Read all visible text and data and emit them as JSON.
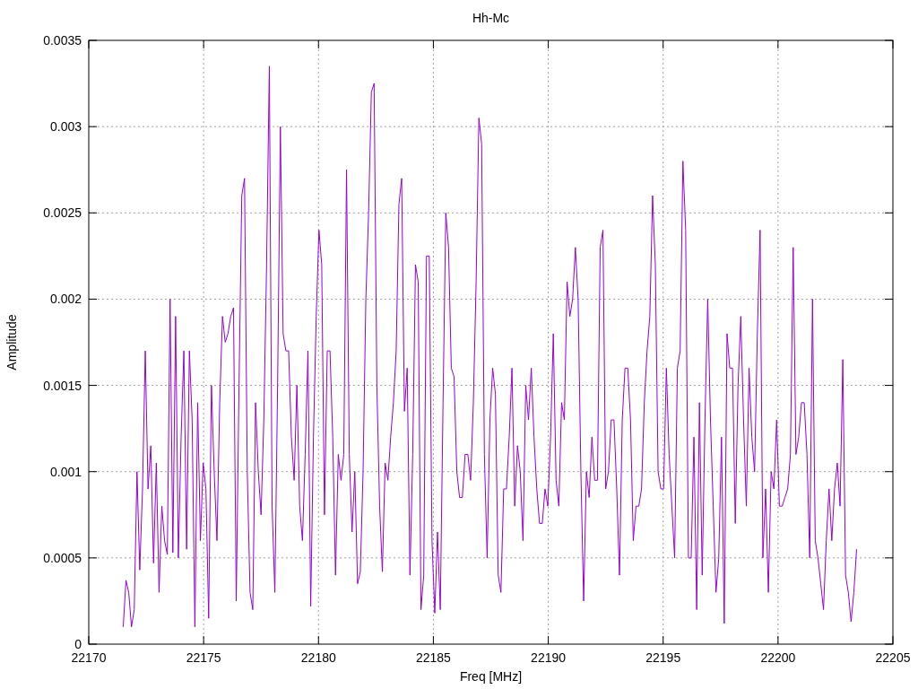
{
  "chart_data": {
    "type": "line",
    "title": "Hh-Mc",
    "xlabel": "Freq [MHz]",
    "ylabel": "Amplitude",
    "xlim": [
      22170,
      22205
    ],
    "ylim": [
      0,
      0.0035
    ],
    "xticks": [
      22170,
      22175,
      22180,
      22185,
      22190,
      22195,
      22200,
      22205
    ],
    "yticks": [
      0,
      0.0005,
      0.001,
      0.0015,
      0.002,
      0.0025,
      0.003,
      0.0035
    ],
    "x": [
      22171.5,
      22171.62,
      22171.74,
      22171.86,
      22171.98,
      22172.1,
      22172.22,
      22172.34,
      22172.46,
      22172.58,
      22172.7,
      22172.82,
      22172.94,
      22173.06,
      22173.18,
      22173.3,
      22173.42,
      22173.54,
      22173.66,
      22173.78,
      22173.9,
      22174.02,
      22174.14,
      22174.26,
      22174.38,
      22174.5,
      22174.62,
      22174.74,
      22174.86,
      22174.98,
      22175.1,
      22175.22,
      22175.34,
      22175.46,
      22175.58,
      22175.7,
      22175.82,
      22175.94,
      22176.06,
      22176.18,
      22176.3,
      22176.42,
      22176.54,
      22176.66,
      22176.78,
      22176.9,
      22177.02,
      22177.14,
      22177.26,
      22177.38,
      22177.5,
      22177.62,
      22177.74,
      22177.86,
      22177.98,
      22178.1,
      22178.22,
      22178.34,
      22178.46,
      22178.58,
      22178.7,
      22178.82,
      22178.94,
      22179.06,
      22179.18,
      22179.3,
      22179.42,
      22179.54,
      22179.66,
      22179.78,
      22179.9,
      22180.02,
      22180.14,
      22180.26,
      22180.38,
      22180.5,
      22180.62,
      22180.74,
      22180.86,
      22180.98,
      22181.1,
      22181.22,
      22181.34,
      22181.46,
      22181.58,
      22181.7,
      22181.82,
      22181.94,
      22182.06,
      22182.18,
      22182.3,
      22182.42,
      22182.54,
      22182.66,
      22182.78,
      22182.9,
      22183.02,
      22183.14,
      22183.26,
      22183.38,
      22183.5,
      22183.62,
      22183.74,
      22183.86,
      22183.98,
      22184.1,
      22184.22,
      22184.34,
      22184.46,
      22184.58,
      22184.7,
      22184.82,
      22184.94,
      22185.06,
      22185.18,
      22185.3,
      22185.42,
      22185.54,
      22185.66,
      22185.78,
      22185.9,
      22186.02,
      22186.14,
      22186.26,
      22186.38,
      22186.5,
      22186.62,
      22186.74,
      22186.86,
      22186.98,
      22187.1,
      22187.22,
      22187.34,
      22187.46,
      22187.58,
      22187.7,
      22187.82,
      22187.94,
      22188.06,
      22188.18,
      22188.3,
      22188.42,
      22188.54,
      22188.66,
      22188.78,
      22188.9,
      22189.02,
      22189.14,
      22189.26,
      22189.38,
      22189.5,
      22189.62,
      22189.74,
      22189.86,
      22189.98,
      22190.1,
      22190.22,
      22190.34,
      22190.46,
      22190.58,
      22190.7,
      22190.82,
      22190.94,
      22191.06,
      22191.18,
      22191.3,
      22191.42,
      22191.54,
      22191.66,
      22191.78,
      22191.9,
      22192.02,
      22192.14,
      22192.26,
      22192.38,
      22192.5,
      22192.62,
      22192.74,
      22192.86,
      22192.98,
      22193.1,
      22193.22,
      22193.34,
      22193.46,
      22193.58,
      22193.7,
      22193.82,
      22193.94,
      22194.06,
      22194.18,
      22194.3,
      22194.42,
      22194.54,
      22194.66,
      22194.78,
      22194.9,
      22195.02,
      22195.14,
      22195.26,
      22195.38,
      22195.5,
      22195.62,
      22195.74,
      22195.86,
      22195.98,
      22196.1,
      22196.22,
      22196.34,
      22196.46,
      22196.58,
      22196.7,
      22196.82,
      22196.94,
      22197.06,
      22197.18,
      22197.3,
      22197.42,
      22197.54,
      22197.66,
      22197.78,
      22197.9,
      22198.02,
      22198.14,
      22198.26,
      22198.38,
      22198.5,
      22198.62,
      22198.74,
      22198.86,
      22198.98,
      22199.1,
      22199.22,
      22199.34,
      22199.46,
      22199.58,
      22199.7,
      22199.82,
      22199.94,
      22200.06,
      22200.18,
      22200.3,
      22200.42,
      22200.54,
      22200.66,
      22200.78,
      22200.9,
      22201.02,
      22201.14,
      22201.26,
      22201.38,
      22201.5,
      22201.62,
      22201.74,
      22201.86,
      22201.98,
      22202.1,
      22202.22,
      22202.34,
      22202.46,
      22202.58,
      22202.7,
      22202.82,
      22202.94,
      22203.06,
      22203.18,
      22203.3,
      22203.42
    ],
    "grid": true,
    "series": [
      {
        "color": "#9400d3",
        "values": [
          0.0001,
          0.00037,
          0.0003,
          0.0001,
          0.0002,
          0.001,
          0.00043,
          0.0009,
          0.0017,
          0.0009,
          0.00115,
          0.00047,
          0.00105,
          0.0003,
          0.0008,
          0.0006,
          0.00052,
          0.002,
          0.00053,
          0.0019,
          0.0005,
          0.0012,
          0.0017,
          0.00055,
          0.0017,
          0.0013,
          0.0001,
          0.0014,
          0.0006,
          0.00105,
          0.0009,
          0.00015,
          0.0015,
          0.001,
          0.0006,
          0.0014,
          0.0019,
          0.00175,
          0.0018,
          0.0019,
          0.00195,
          0.00025,
          0.0015,
          0.0026,
          0.0027,
          0.001,
          0.0003,
          0.0002,
          0.0014,
          0.001,
          0.00075,
          0.0013,
          0.0022,
          0.00335,
          0.0008,
          0.0003,
          0.0015,
          0.003,
          0.0018,
          0.0017,
          0.0017,
          0.0012,
          0.00095,
          0.0015,
          0.0008,
          0.0006,
          0.0011,
          0.0017,
          0.00022,
          0.0012,
          0.0019,
          0.0024,
          0.0022,
          0.00075,
          0.0017,
          0.0017,
          0.0012,
          0.0004,
          0.0011,
          0.00095,
          0.0011,
          0.00275,
          0.0011,
          0.00065,
          0.001,
          0.00035,
          0.00042,
          0.001,
          0.002,
          0.0025,
          0.0032,
          0.00325,
          0.0015,
          0.0008,
          0.00042,
          0.00105,
          0.00095,
          0.0012,
          0.0014,
          0.0017,
          0.00255,
          0.0027,
          0.00135,
          0.0016,
          0.0004,
          0.0011,
          0.0022,
          0.0021,
          0.0002,
          0.0004,
          0.00225,
          0.00225,
          0.0006,
          0.00018,
          0.00065,
          0.0002,
          0.0014,
          0.0025,
          0.0023,
          0.0016,
          0.00155,
          0.001,
          0.00085,
          0.00085,
          0.0011,
          0.0011,
          0.00095,
          0.0014,
          0.0021,
          0.00305,
          0.0029,
          0.0011,
          0.0005,
          0.0013,
          0.0016,
          0.00145,
          0.0004,
          0.0003,
          0.0009,
          0.0009,
          0.0012,
          0.0016,
          0.0008,
          0.00115,
          0.001,
          0.0006,
          0.0015,
          0.0013,
          0.0016,
          0.0012,
          0.0009,
          0.0007,
          0.0007,
          0.0009,
          0.0008,
          0.0012,
          0.0018,
          0.00095,
          0.0008,
          0.0014,
          0.0013,
          0.0021,
          0.0019,
          0.002,
          0.0023,
          0.002,
          0.001,
          0.00025,
          0.001,
          0.00085,
          0.0012,
          0.00095,
          0.00095,
          0.0023,
          0.0024,
          0.0009,
          0.001,
          0.0013,
          0.0013,
          0.0009,
          0.0004,
          0.0013,
          0.0016,
          0.0016,
          0.0013,
          0.0006,
          0.0008,
          0.0008,
          0.0009,
          0.0014,
          0.0017,
          0.0019,
          0.0026,
          0.0022,
          0.001,
          0.0009,
          0.0009,
          0.0016,
          0.0011,
          0.0008,
          0.0005,
          0.0016,
          0.0017,
          0.0028,
          0.0024,
          0.0005,
          0.0005,
          0.0012,
          0.0002,
          0.0014,
          0.0004,
          0.0013,
          0.002,
          0.0013,
          0.0008,
          0.0003,
          0.0005,
          0.0012,
          0.00012,
          0.0018,
          0.0016,
          0.0016,
          0.0007,
          0.0015,
          0.0019,
          0.0013,
          0.0008,
          0.0016,
          0.0012,
          0.001,
          0.0018,
          0.0024,
          0.0005,
          0.0009,
          0.0003,
          0.001,
          0.0009,
          0.0013,
          0.0008,
          0.0008,
          0.00085,
          0.0009,
          0.0011,
          0.0023,
          0.0011,
          0.0012,
          0.0014,
          0.0014,
          0.0011,
          0.0005,
          0.002,
          0.0006,
          0.0005,
          0.00035,
          0.0002,
          0.0006,
          0.0009,
          0.0006,
          0.0009,
          0.00105,
          0.0008,
          0.00165,
          0.0004,
          0.0003,
          0.00013,
          0.0003,
          0.00055
        ]
      }
    ]
  }
}
